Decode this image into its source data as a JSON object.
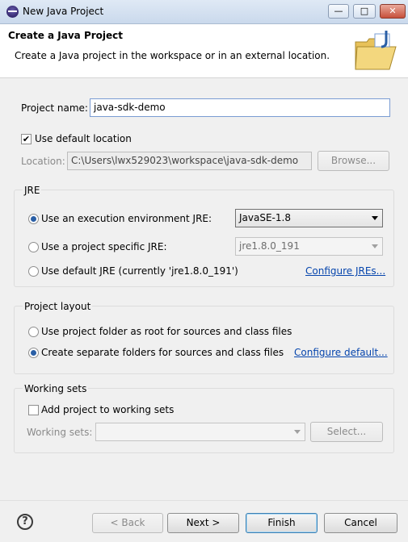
{
  "window": {
    "title": "New Java Project",
    "min": "—",
    "max": "□",
    "close": "✕"
  },
  "header": {
    "title": "Create a Java Project",
    "description": "Create a Java project in the workspace or in an external location.",
    "icon": "java-project-folder-icon"
  },
  "project": {
    "name_label": "Project name:",
    "name_value": "java-sdk-demo"
  },
  "location": {
    "use_default_label": "Use default location",
    "use_default_checked": true,
    "label": "Location:",
    "value": "C:\\Users\\lwx529023\\workspace\\java-sdk-demo",
    "browse_label": "Browse..."
  },
  "jre": {
    "group_title": "JRE",
    "exec_env_label": "Use an execution environment JRE:",
    "exec_env_value": "JavaSE-1.8",
    "specific_label": "Use a project specific JRE:",
    "specific_value": "jre1.8.0_191",
    "default_label": "Use default JRE (currently 'jre1.8.0_191')",
    "configure_link": "Configure JREs...",
    "selected": "exec_env"
  },
  "layout": {
    "group_title": "Project layout",
    "option_root": "Use project folder as root for sources and class files",
    "option_separate": "Create separate folders for sources and class files",
    "configure_link": "Configure default...",
    "selected": "separate"
  },
  "working_sets": {
    "group_title": "Working sets",
    "add_label": "Add project to working sets",
    "add_checked": false,
    "label": "Working sets:",
    "value": "",
    "select_label": "Select..."
  },
  "footer": {
    "help": "?",
    "back": "< Back",
    "next": "Next >",
    "finish": "Finish",
    "cancel": "Cancel"
  },
  "colors": {
    "accent": "#3c7fb1",
    "link": "#0645ad",
    "titlebar": "#cad9ec"
  }
}
